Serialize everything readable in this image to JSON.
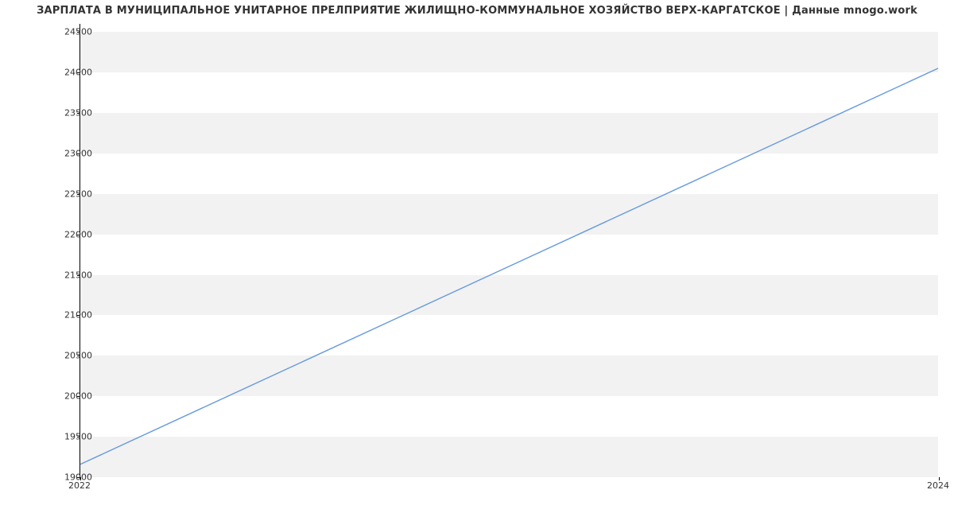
{
  "chart_data": {
    "type": "line",
    "title": "ЗАРПЛАТА В МУНИЦИПАЛЬНОЕ УНИТАРНОЕ ПРЕЛПРИЯТИЕ ЖИЛИЩНО-КОММУНАЛЬНОЕ ХОЗЯЙСТВО ВЕРХ-КАРГАТСКОЕ | Данные mnogo.work",
    "xlabel": "",
    "ylabel": "",
    "x_ticks": [
      "2022",
      "2024"
    ],
    "y_ticks": [
      19000,
      19500,
      20000,
      20500,
      21000,
      21500,
      22000,
      22500,
      23000,
      23500,
      24000,
      24500
    ],
    "ylim": [
      19000,
      24600
    ],
    "series": [
      {
        "name": "salary",
        "x": [
          2022,
          2024
        ],
        "values": [
          19150,
          24050
        ]
      }
    ],
    "line_color": "#6699e0",
    "grid_band_color": "#f2f2f2"
  }
}
